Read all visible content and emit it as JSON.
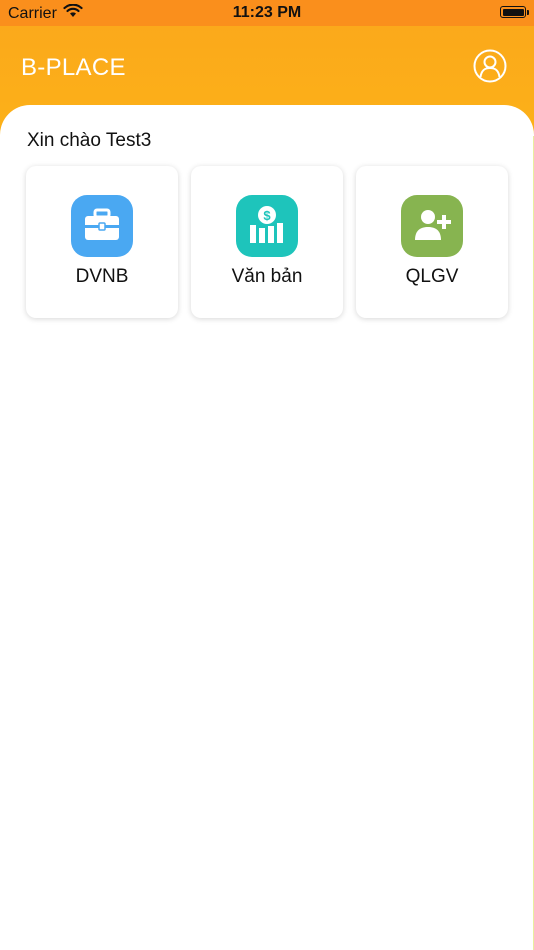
{
  "status_bar": {
    "carrier": "Carrier",
    "time": "11:23 PM"
  },
  "header": {
    "title": "B-PLACE",
    "profile_icon": "user-circle-icon"
  },
  "greeting": {
    "prefix": "Xin chào",
    "name": "Test3"
  },
  "cards": [
    {
      "label": "DVNB",
      "icon": "briefcase-icon",
      "color": "#4aa8f2"
    },
    {
      "label": "Văn bản",
      "icon": "dollar-chart-icon",
      "color": "#1ec4bb"
    },
    {
      "label": "QLGV",
      "icon": "add-user-icon",
      "color": "#87b450"
    }
  ],
  "colors": {
    "status_bar": "#fa8f1c",
    "header": "#fcb118",
    "card_text": "#111111"
  }
}
